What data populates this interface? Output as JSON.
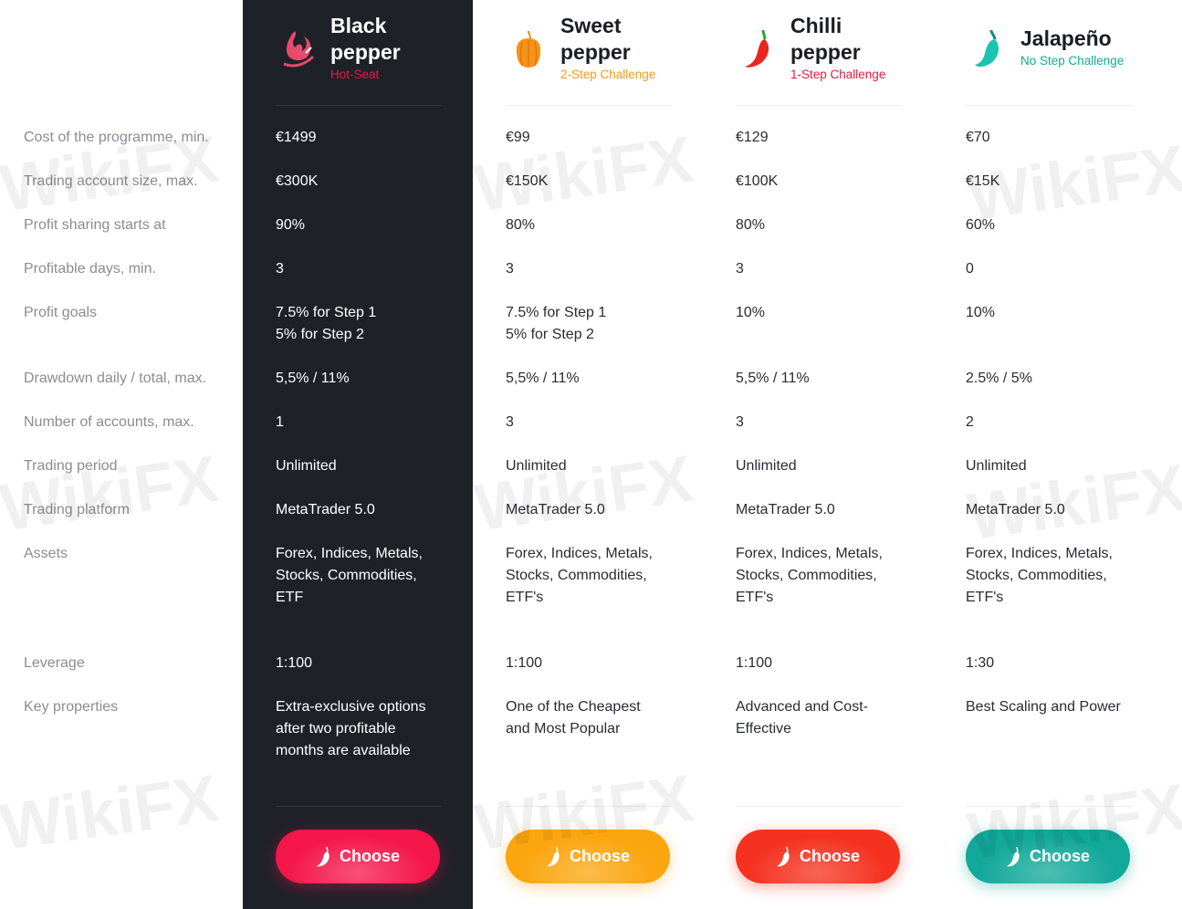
{
  "row_labels": [
    "Cost of the programme, min.",
    "Trading account size, max.",
    "Profit sharing starts at",
    "Profitable days, min.",
    "Profit goals",
    "Drawdown daily / total, max.",
    "Number of accounts, max.",
    "Trading period",
    "Trading platform",
    "Assets",
    "Leverage",
    "Key properties"
  ],
  "plans": [
    {
      "name_line1": "Black",
      "name_line2": "pepper",
      "subtitle": "Hot-Seat",
      "subtitle_color": "#e8183f",
      "icon": "flaming-pepper-icon",
      "button": "Choose",
      "button_color": "#f5174a",
      "values": [
        "€1499",
        "€300K",
        "90%",
        "3",
        [
          "7.5% for Step 1",
          "5% for Step 2"
        ],
        "5,5% / 11%",
        "1",
        "Unlimited",
        "MetaTrader 5.0",
        [
          "Forex, Indices, Metals,",
          "Stocks, Commodities,",
          "ETF"
        ],
        "1:100",
        [
          "Extra-exclusive options",
          "after two profitable",
          "months are available"
        ]
      ]
    },
    {
      "name_line1": "Sweet",
      "name_line2": "pepper",
      "subtitle": "2-Step Challenge",
      "subtitle_color": "#f39a1c",
      "icon": "sweet-pepper-icon",
      "button": "Choose",
      "button_color": "#fba50f",
      "values": [
        "€99",
        "€150K",
        "80%",
        "3",
        [
          "7.5% for Step 1",
          "5% for Step 2"
        ],
        "5,5% / 11%",
        "3",
        "Unlimited",
        "MetaTrader 5.0",
        [
          "Forex, Indices, Metals,",
          "Stocks, Commodities,",
          "ETF's"
        ],
        "1:100",
        [
          "One of the Cheapest",
          "and Most Popular"
        ]
      ]
    },
    {
      "name_line1": "Chilli",
      "name_line2": "pepper",
      "subtitle": "1-Step Challenge",
      "subtitle_color": "#e8183f",
      "icon": "chilli-pepper-icon",
      "button": "Choose",
      "button_color": "#f5311f",
      "values": [
        "€129",
        "€100K",
        "80%",
        "3",
        [
          "10%"
        ],
        "5,5% / 11%",
        "3",
        "Unlimited",
        "MetaTrader 5.0",
        [
          "Forex, Indices, Metals,",
          "Stocks, Commodities,",
          "ETF's"
        ],
        "1:100",
        [
          "Advanced and Cost-",
          "Effective"
        ]
      ]
    },
    {
      "name_line1": "Jalapeño",
      "name_line2": "",
      "subtitle": "No Step Challenge",
      "subtitle_color": "#14a99a",
      "icon": "jalapeno-icon",
      "button": "Choose",
      "button_color": "#12a89a",
      "values": [
        "€70",
        "€15K",
        "60%",
        "0",
        [
          "10%"
        ],
        "2.5% / 5%",
        "2",
        "Unlimited",
        "MetaTrader 5.0",
        [
          "Forex, Indices, Metals,",
          "Stocks, Commodities,",
          "ETF's"
        ],
        "1:30",
        [
          "Best Scaling and Power"
        ]
      ]
    }
  ],
  "watermark": "WikiFX"
}
